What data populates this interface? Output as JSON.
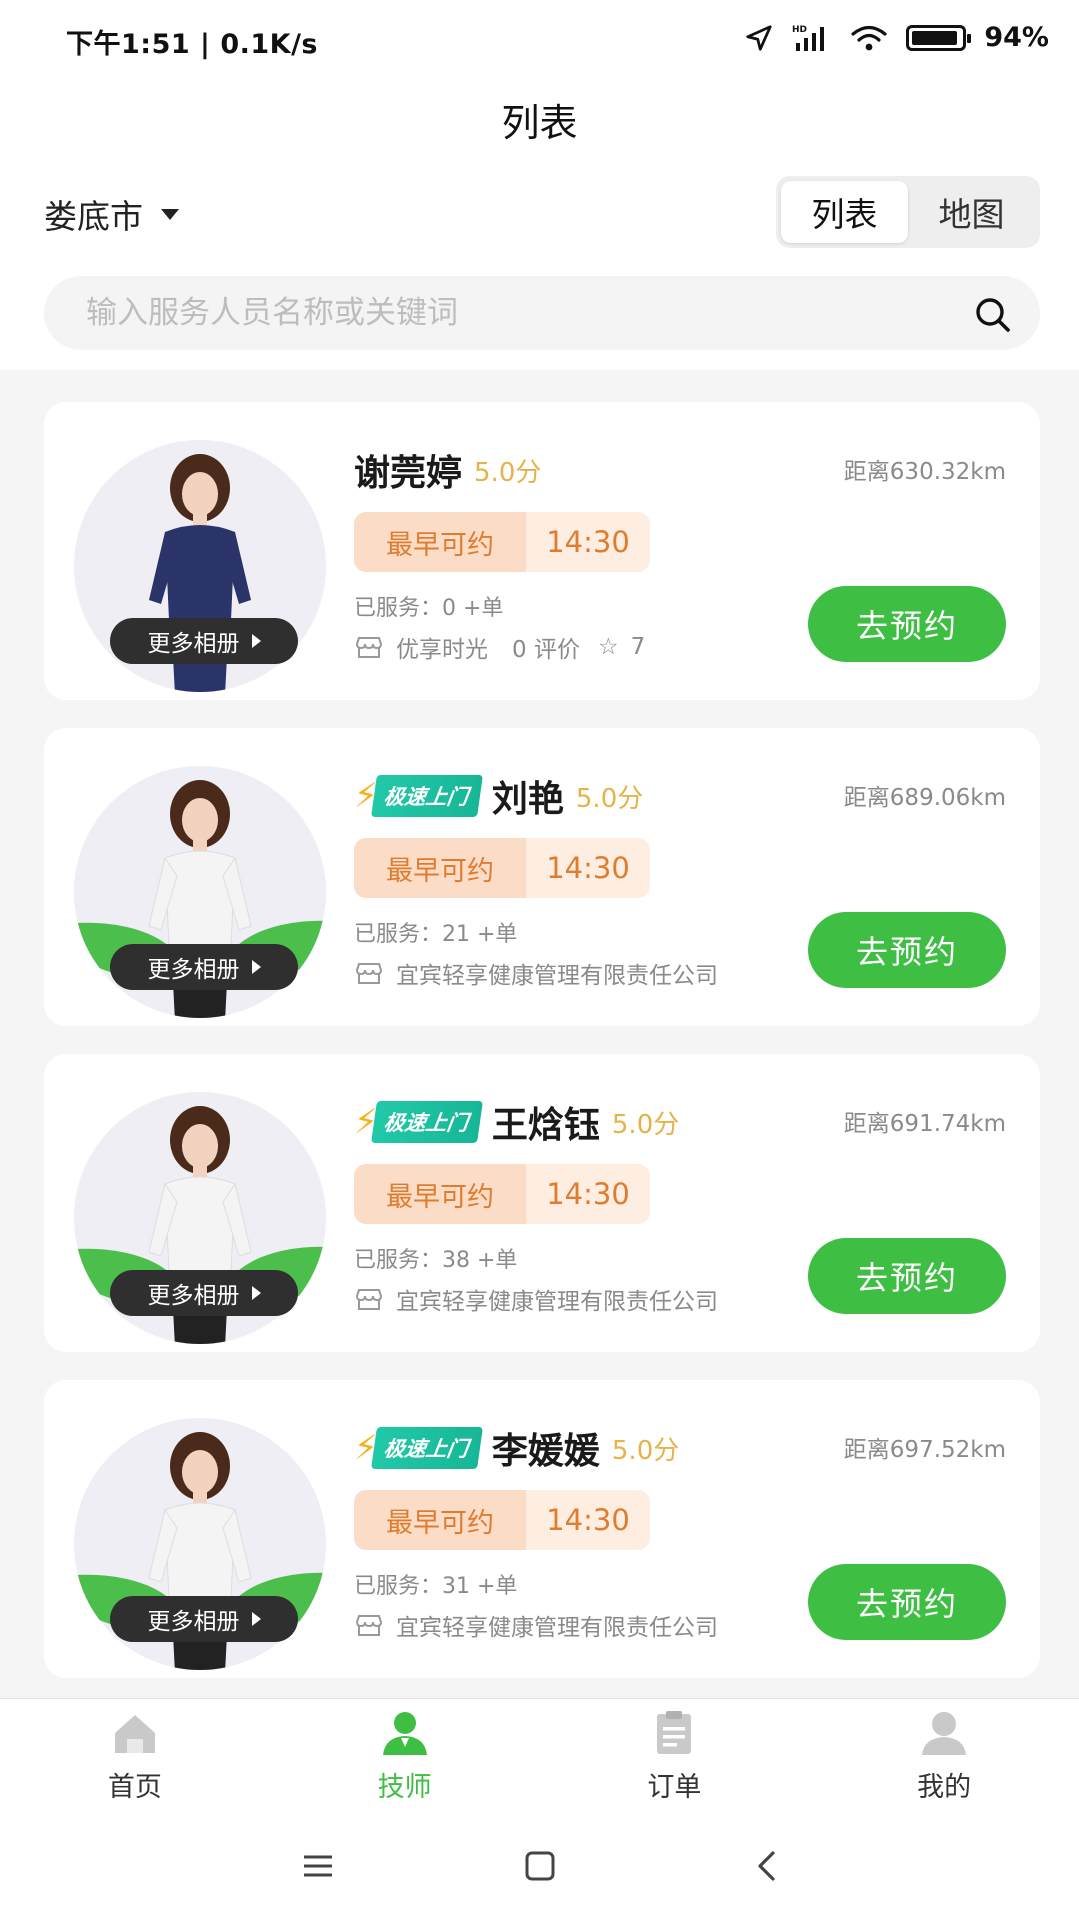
{
  "status_bar": {
    "time": "下午1:51 | 0.1K/s",
    "battery": "94%",
    "battery_level": 0.94
  },
  "header": {
    "title": "列表",
    "city": "娄底市"
  },
  "view_toggle": {
    "list": "列表",
    "map": "地图",
    "selected": "list"
  },
  "search": {
    "placeholder": "输入服务人员名称或关键词",
    "value": ""
  },
  "labels": {
    "earliest": "最早可约",
    "more_album": "更多相册",
    "book": "去预约",
    "express_badge": "极速上门"
  },
  "technicians": [
    {
      "name": "谢莞婷",
      "score": "5.0分",
      "distance": "距离630.32km",
      "time": "14:30",
      "served": "已服务：0 +单",
      "store": "优享时光",
      "extra": "0 评价",
      "stars": "7",
      "express": false
    },
    {
      "name": "刘艳",
      "score": "5.0分",
      "distance": "距离689.06km",
      "time": "14:30",
      "served": "已服务：21 +单",
      "store": "宜宾轻享健康管理有限责任公司",
      "express": true
    },
    {
      "name": "王焓钰",
      "score": "5.0分",
      "distance": "距离691.74km",
      "time": "14:30",
      "served": "已服务：38 +单",
      "store": "宜宾轻享健康管理有限责任公司",
      "express": true
    },
    {
      "name": "李媛媛",
      "score": "5.0分",
      "distance": "距离697.52km",
      "time": "14:30",
      "served": "已服务：31 +单",
      "store": "宜宾轻享健康管理有限责任公司",
      "express": true
    }
  ],
  "tabbar": [
    {
      "label": "首页",
      "icon": "home-icon"
    },
    {
      "label": "技师",
      "icon": "technician-icon",
      "active": true
    },
    {
      "label": "订单",
      "icon": "order-icon"
    },
    {
      "label": "我的",
      "icon": "profile-icon"
    }
  ],
  "colors": {
    "accent": "#3fbe44",
    "score": "#e6b34a",
    "tag_text": "#e07c2f",
    "badge": "#17b696"
  }
}
